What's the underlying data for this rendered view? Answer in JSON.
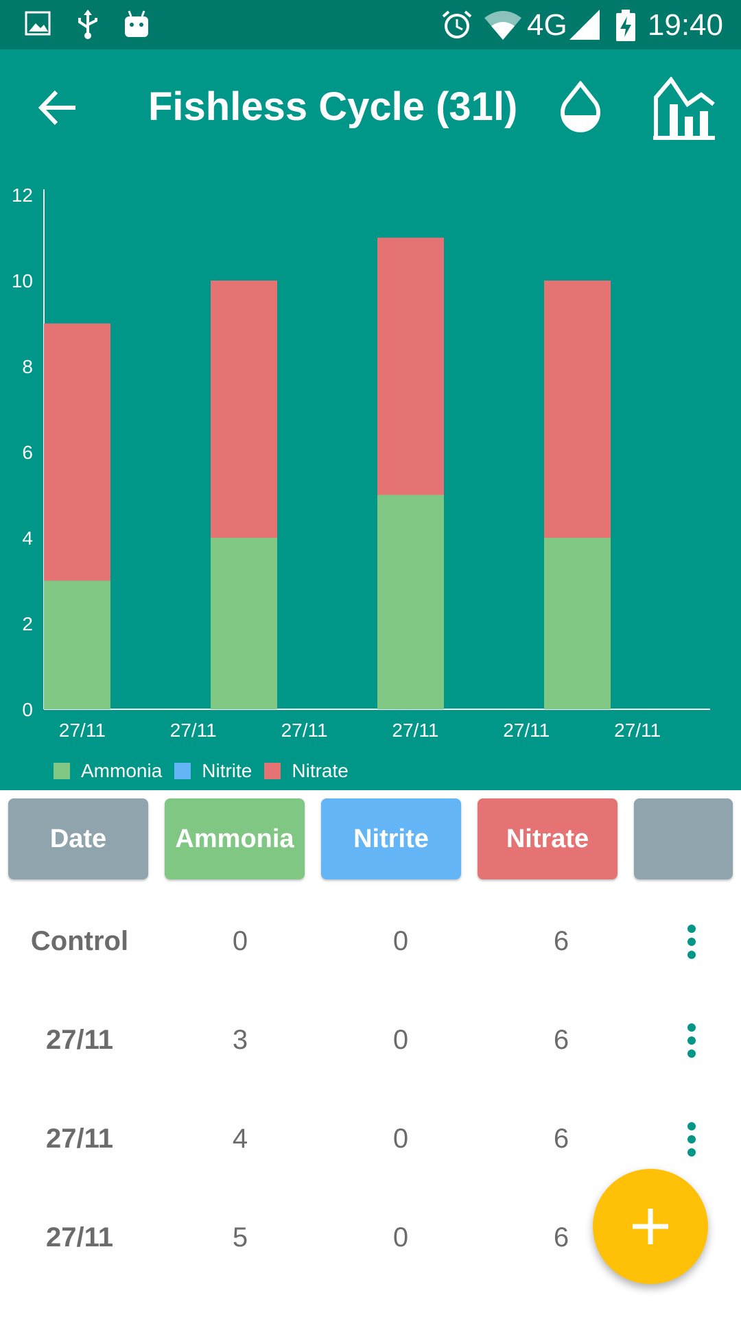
{
  "status_bar": {
    "time": "19:40",
    "network": "4G",
    "icons": [
      "image-icon",
      "usb-icon",
      "android-icon",
      "alarm-icon",
      "wifi-icon",
      "signal-icon",
      "battery-charging-icon"
    ]
  },
  "app_bar": {
    "title": "Fishless Cycle (31l)",
    "back_icon": "arrow-back-icon",
    "action_icons": [
      "water-drop-icon",
      "chart-icon"
    ]
  },
  "colors": {
    "primary": "#009688",
    "primary_dark": "#00796b",
    "ammonia": "#81c784",
    "nitrite": "#64b5f6",
    "nitrate": "#e57373",
    "date_header": "#90a4ae",
    "fab": "#ffc107",
    "menu_dots": "#009688"
  },
  "chart_data": {
    "type": "bar",
    "stacked": true,
    "categories": [
      "27/11",
      "27/11",
      "27/11",
      "27/11",
      "27/11",
      "27/11"
    ],
    "series": [
      {
        "name": "Ammonia",
        "values": [
          3,
          4,
          5,
          4,
          0,
          0
        ],
        "color": "#81c784"
      },
      {
        "name": "Nitrite",
        "values": [
          0,
          0,
          0,
          0,
          0,
          0
        ],
        "color": "#64b5f6"
      },
      {
        "name": "Nitrate",
        "values": [
          6,
          6,
          6,
          6,
          0,
          0
        ],
        "color": "#e57373"
      }
    ],
    "yticks": [
      "0",
      "2",
      "4",
      "6",
      "8",
      "10",
      "12"
    ],
    "ylim": [
      0,
      12
    ],
    "legend": "bottom-left",
    "grid": false
  },
  "table": {
    "headers": [
      "Date",
      "Ammonia",
      "Nitrite",
      "Nitrate",
      ""
    ],
    "rows": [
      {
        "date": "Control",
        "ammonia": "0",
        "nitrite": "0",
        "nitrate": "6"
      },
      {
        "date": "27/11",
        "ammonia": "3",
        "nitrite": "0",
        "nitrate": "6"
      },
      {
        "date": "27/11",
        "ammonia": "4",
        "nitrite": "0",
        "nitrate": "6"
      },
      {
        "date": "27/11",
        "ammonia": "5",
        "nitrite": "0",
        "nitrate": "6"
      }
    ]
  },
  "fab": {
    "icon": "add-icon"
  }
}
